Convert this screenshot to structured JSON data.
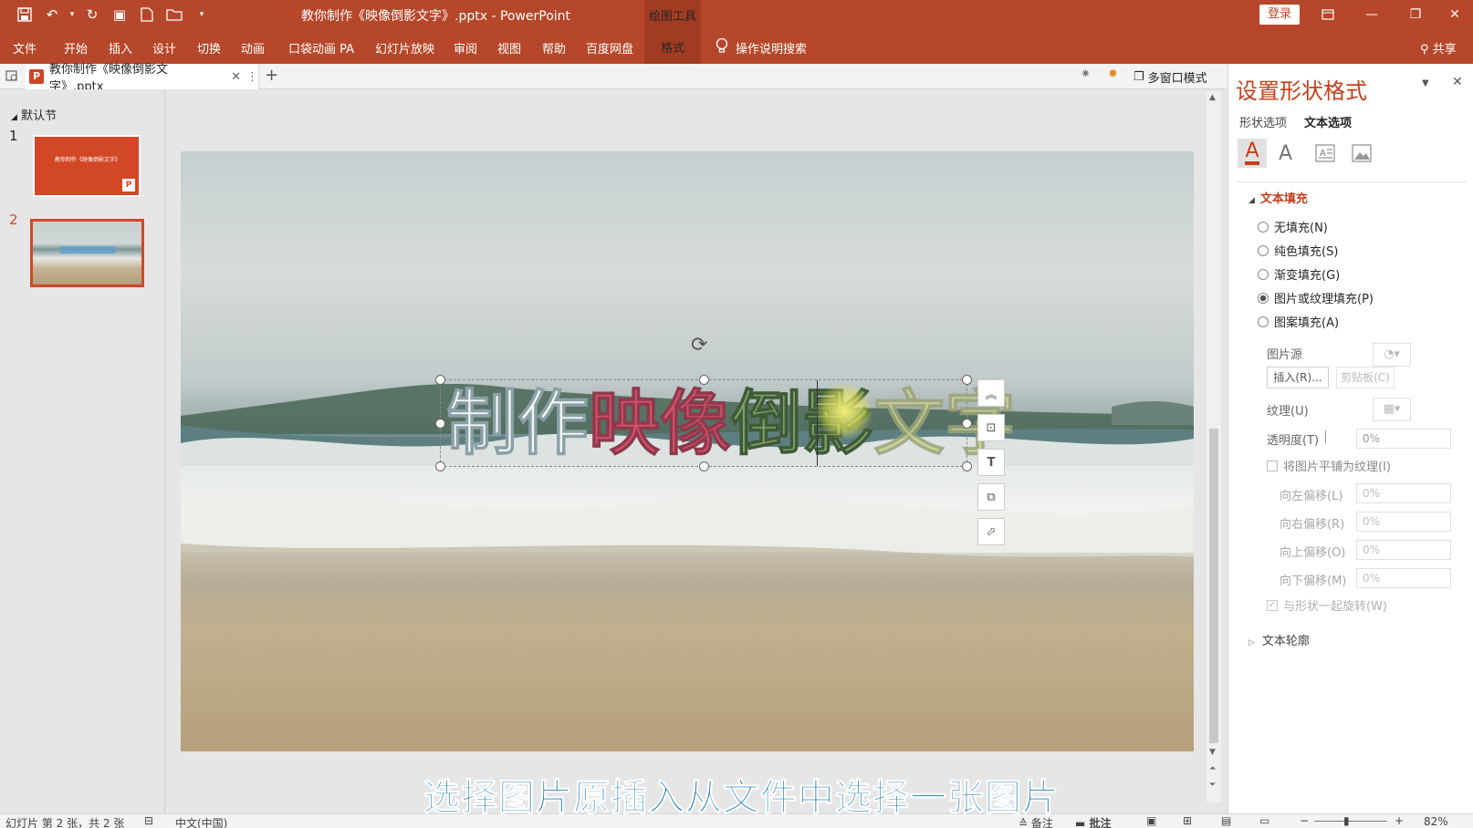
{
  "titlebar": {
    "doc_title": "教你制作《映像倒影文字》.pptx  -  PowerPoint",
    "context_tab": "绘图工具",
    "login": "登录"
  },
  "ribbon": {
    "tabs": [
      "文件",
      "开始",
      "插入",
      "设计",
      "切换",
      "动画",
      "口袋动画 PA",
      "幻灯片放映",
      "审阅",
      "视图",
      "帮助",
      "百度网盘",
      "格式"
    ],
    "tell_me": "操作说明搜索",
    "share": "共享"
  },
  "doc_tab": {
    "name": "教你制作《映像倒影文字》.pptx",
    "multi_window": "多窗口模式"
  },
  "slides_panel": {
    "section": "默认节",
    "thumb1_title": "教你制作《映像倒影文字》",
    "numbers": [
      "1",
      "2"
    ]
  },
  "slide": {
    "text_parts": [
      "制作",
      "映像",
      "倒影",
      "文字"
    ]
  },
  "format_pane": {
    "title": "设置形状格式",
    "tab_shape": "形状选项",
    "tab_text": "文本选项",
    "text_fill_header": "文本填充",
    "options": [
      "无填充(N)",
      "纯色填充(S)",
      "渐变填充(G)",
      "图片或纹理填充(P)",
      "图案填充(A)"
    ],
    "picture_source": "图片源",
    "insert_btn": "插入(R)...",
    "clipboard_btn": "剪贴板(C)",
    "texture": "纹理(U)",
    "transparency": "透明度(T)",
    "transparency_value": "0%",
    "tile": "将图片平铺为纹理(I)",
    "offsets": [
      {
        "label": "向左偏移(L)",
        "value": "0%"
      },
      {
        "label": "向右偏移(R)",
        "value": "0%"
      },
      {
        "label": "向上偏移(O)",
        "value": "0%"
      },
      {
        "label": "向下偏移(M)",
        "value": "0%"
      }
    ],
    "rotate_with_shape": "与形状一起旋转(W)",
    "text_outline": "文本轮廓"
  },
  "status": {
    "slide_info": "幻灯片 第 2 张，共 2 张",
    "language": "中文(中国)",
    "notes": "备注",
    "comments": "批注",
    "zoom": "82%"
  },
  "caption": "选择图片原插入从文件中选择一张图片",
  "colors": {
    "accent": "#b7472a",
    "caption": "#1a7bbd"
  }
}
